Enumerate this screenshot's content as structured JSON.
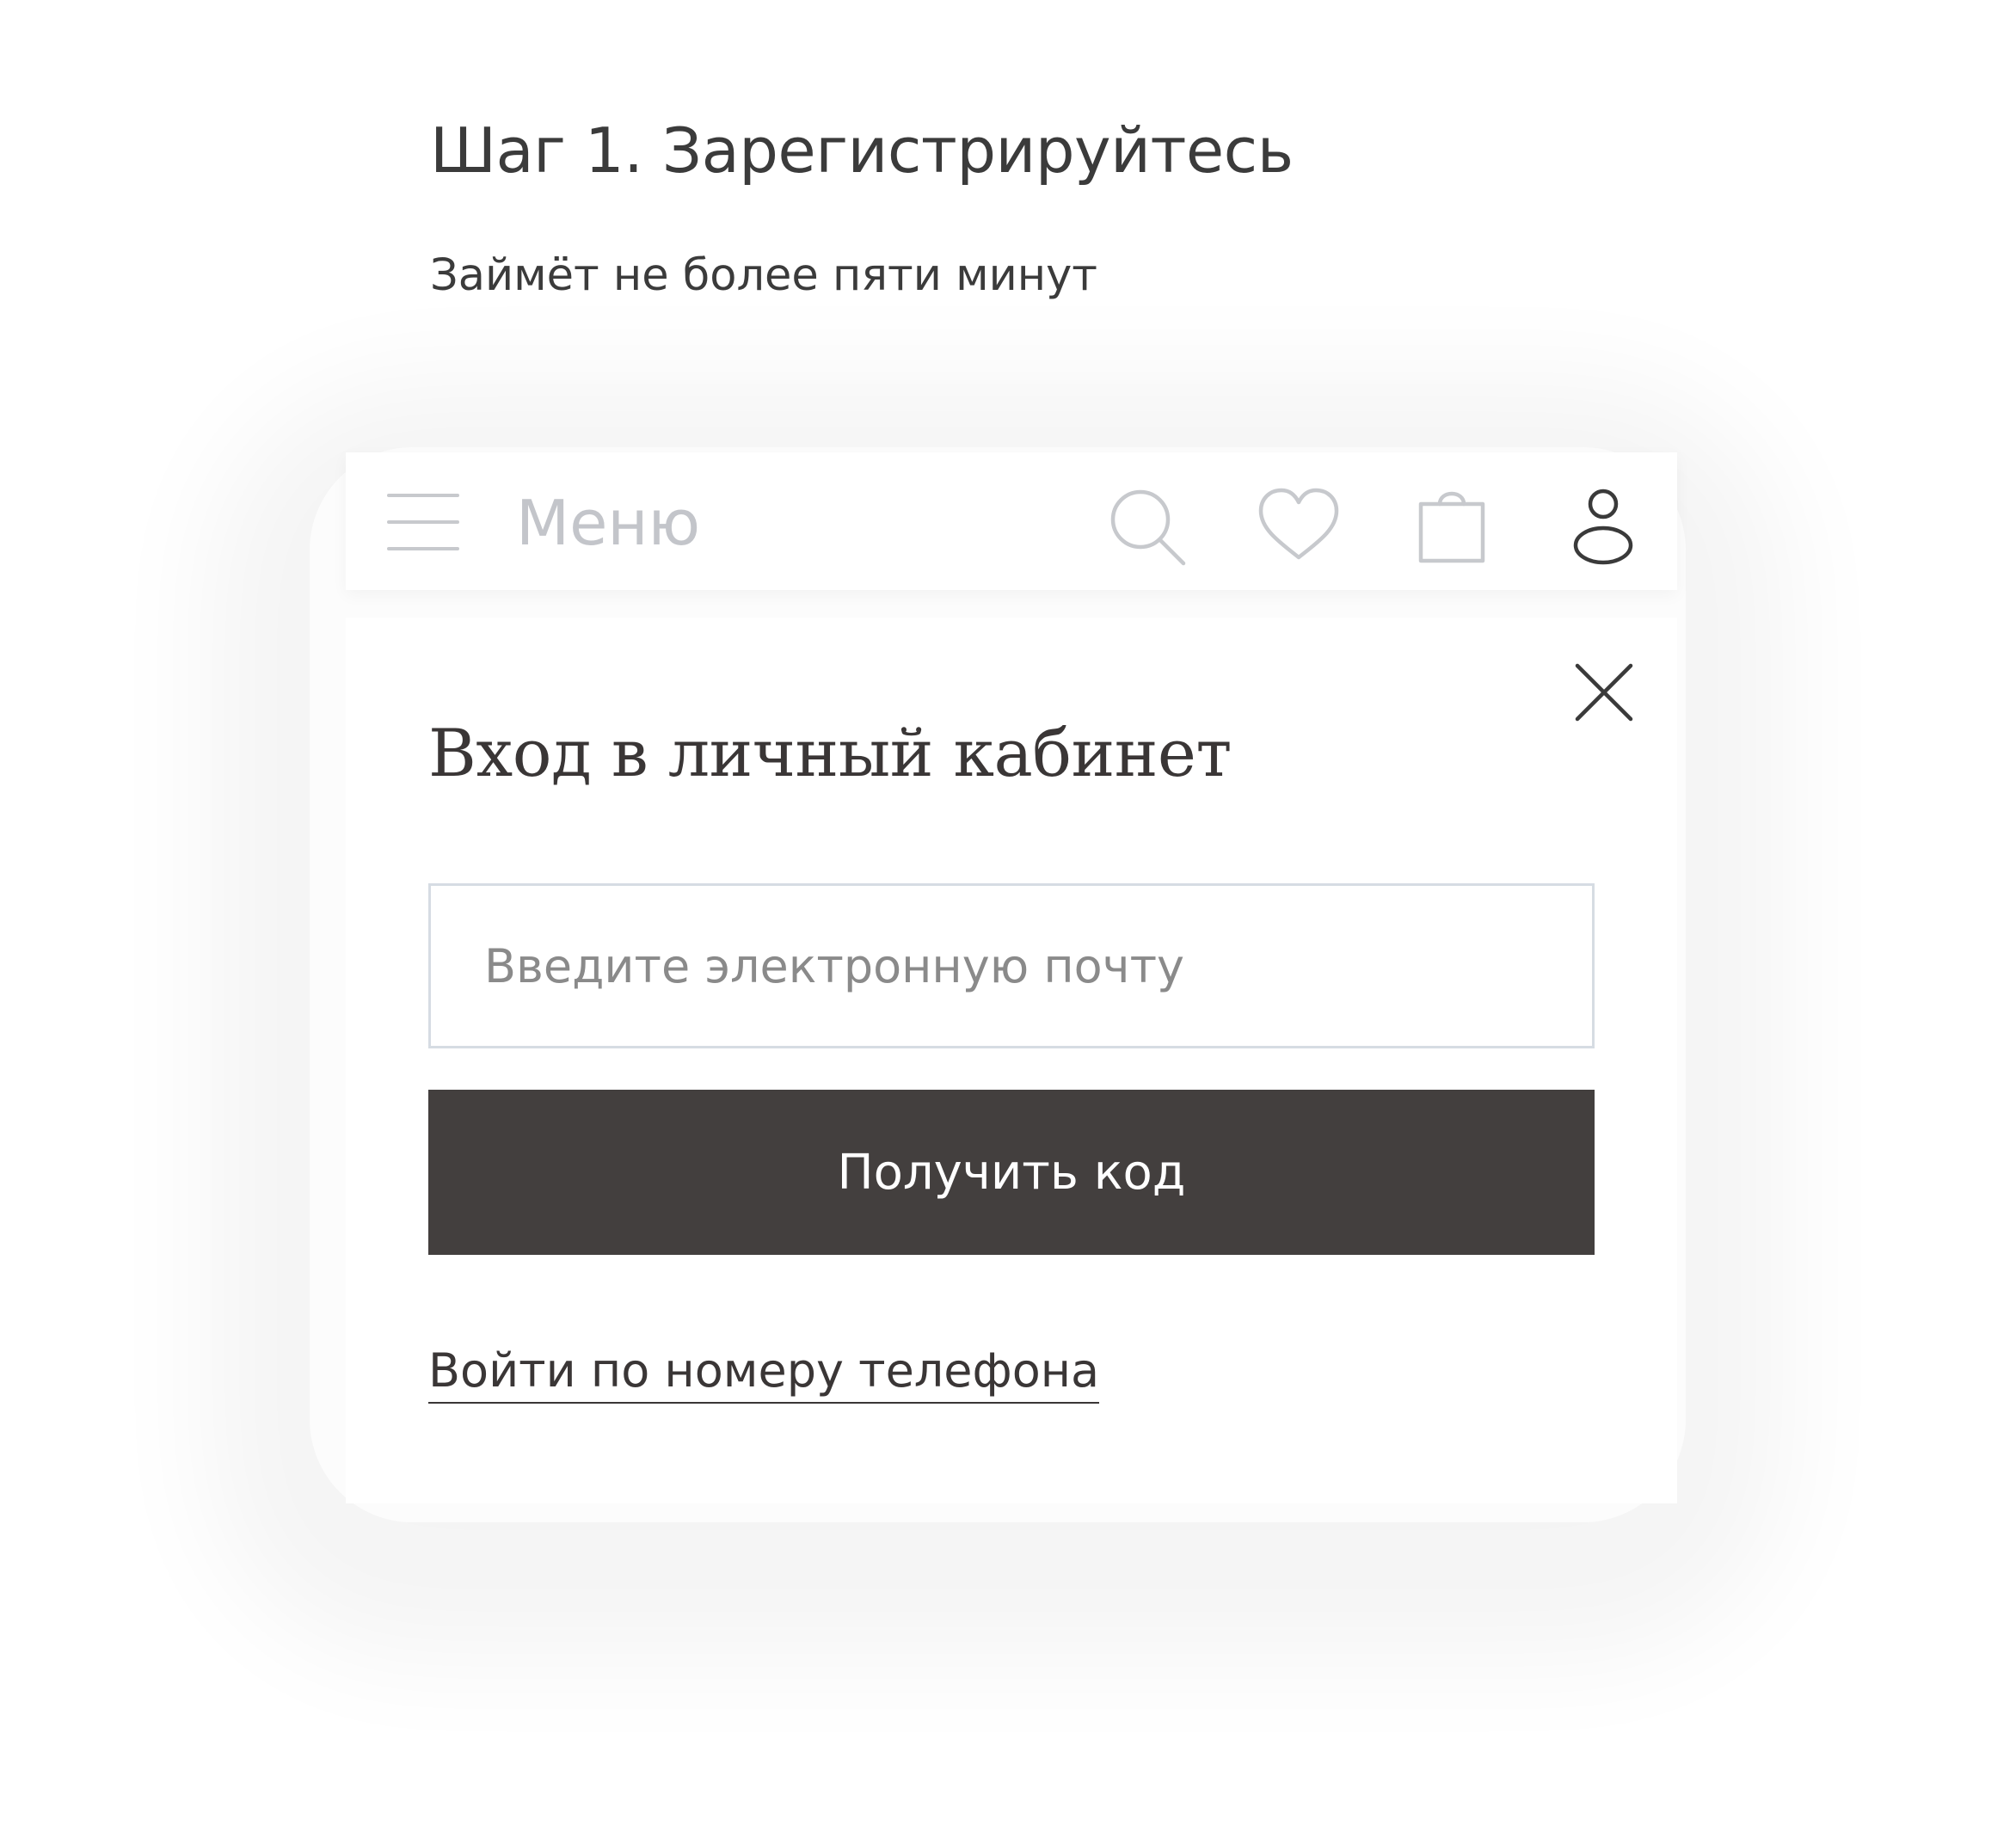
{
  "step": {
    "title": "Шаг 1. Зарегистрируйтесь",
    "subtitle": "Займёт не более пяти минут"
  },
  "header": {
    "menu_icon": "hamburger-icon",
    "menu_label": "Меню",
    "icons": [
      {
        "name": "search-icon",
        "color": "#c7c9cd"
      },
      {
        "name": "heart-icon",
        "color": "#c7c9cd"
      },
      {
        "name": "shopping-bag-icon",
        "color": "#c7c9cd"
      },
      {
        "name": "user-icon",
        "color": "#3a3a3a"
      }
    ]
  },
  "login": {
    "close_icon": "close-icon",
    "title": "Вход в личный кабинет",
    "email_placeholder": "Введите электронную почту",
    "email_value": "",
    "submit_label": "Получить код",
    "phone_link_label": "Войти по номеру телефона"
  },
  "colors": {
    "button_bg": "#433f3e",
    "button_text": "#ffffff",
    "input_border": "#d6dce3",
    "muted_icon": "#c7c9cd",
    "text": "#3a3a3a"
  }
}
